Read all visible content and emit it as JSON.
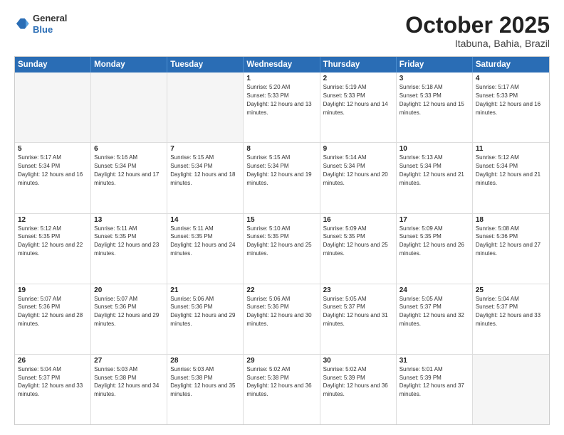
{
  "header": {
    "logo": {
      "general": "General",
      "blue": "Blue"
    },
    "title": "October 2025",
    "location": "Itabuna, Bahia, Brazil"
  },
  "calendar": {
    "days": [
      "Sunday",
      "Monday",
      "Tuesday",
      "Wednesday",
      "Thursday",
      "Friday",
      "Saturday"
    ],
    "rows": [
      [
        {
          "day": "",
          "empty": true
        },
        {
          "day": "",
          "empty": true
        },
        {
          "day": "",
          "empty": true
        },
        {
          "day": "1",
          "sunrise": "5:20 AM",
          "sunset": "5:33 PM",
          "daylight": "12 hours and 13 minutes."
        },
        {
          "day": "2",
          "sunrise": "5:19 AM",
          "sunset": "5:33 PM",
          "daylight": "12 hours and 14 minutes."
        },
        {
          "day": "3",
          "sunrise": "5:18 AM",
          "sunset": "5:33 PM",
          "daylight": "12 hours and 15 minutes."
        },
        {
          "day": "4",
          "sunrise": "5:17 AM",
          "sunset": "5:33 PM",
          "daylight": "12 hours and 16 minutes."
        }
      ],
      [
        {
          "day": "5",
          "sunrise": "5:17 AM",
          "sunset": "5:34 PM",
          "daylight": "12 hours and 16 minutes."
        },
        {
          "day": "6",
          "sunrise": "5:16 AM",
          "sunset": "5:34 PM",
          "daylight": "12 hours and 17 minutes."
        },
        {
          "day": "7",
          "sunrise": "5:15 AM",
          "sunset": "5:34 PM",
          "daylight": "12 hours and 18 minutes."
        },
        {
          "day": "8",
          "sunrise": "5:15 AM",
          "sunset": "5:34 PM",
          "daylight": "12 hours and 19 minutes."
        },
        {
          "day": "9",
          "sunrise": "5:14 AM",
          "sunset": "5:34 PM",
          "daylight": "12 hours and 20 minutes."
        },
        {
          "day": "10",
          "sunrise": "5:13 AM",
          "sunset": "5:34 PM",
          "daylight": "12 hours and 21 minutes."
        },
        {
          "day": "11",
          "sunrise": "5:12 AM",
          "sunset": "5:34 PM",
          "daylight": "12 hours and 21 minutes."
        }
      ],
      [
        {
          "day": "12",
          "sunrise": "5:12 AM",
          "sunset": "5:35 PM",
          "daylight": "12 hours and 22 minutes."
        },
        {
          "day": "13",
          "sunrise": "5:11 AM",
          "sunset": "5:35 PM",
          "daylight": "12 hours and 23 minutes."
        },
        {
          "day": "14",
          "sunrise": "5:11 AM",
          "sunset": "5:35 PM",
          "daylight": "12 hours and 24 minutes."
        },
        {
          "day": "15",
          "sunrise": "5:10 AM",
          "sunset": "5:35 PM",
          "daylight": "12 hours and 25 minutes."
        },
        {
          "day": "16",
          "sunrise": "5:09 AM",
          "sunset": "5:35 PM",
          "daylight": "12 hours and 25 minutes."
        },
        {
          "day": "17",
          "sunrise": "5:09 AM",
          "sunset": "5:35 PM",
          "daylight": "12 hours and 26 minutes."
        },
        {
          "day": "18",
          "sunrise": "5:08 AM",
          "sunset": "5:36 PM",
          "daylight": "12 hours and 27 minutes."
        }
      ],
      [
        {
          "day": "19",
          "sunrise": "5:07 AM",
          "sunset": "5:36 PM",
          "daylight": "12 hours and 28 minutes."
        },
        {
          "day": "20",
          "sunrise": "5:07 AM",
          "sunset": "5:36 PM",
          "daylight": "12 hours and 29 minutes."
        },
        {
          "day": "21",
          "sunrise": "5:06 AM",
          "sunset": "5:36 PM",
          "daylight": "12 hours and 29 minutes."
        },
        {
          "day": "22",
          "sunrise": "5:06 AM",
          "sunset": "5:36 PM",
          "daylight": "12 hours and 30 minutes."
        },
        {
          "day": "23",
          "sunrise": "5:05 AM",
          "sunset": "5:37 PM",
          "daylight": "12 hours and 31 minutes."
        },
        {
          "day": "24",
          "sunrise": "5:05 AM",
          "sunset": "5:37 PM",
          "daylight": "12 hours and 32 minutes."
        },
        {
          "day": "25",
          "sunrise": "5:04 AM",
          "sunset": "5:37 PM",
          "daylight": "12 hours and 33 minutes."
        }
      ],
      [
        {
          "day": "26",
          "sunrise": "5:04 AM",
          "sunset": "5:37 PM",
          "daylight": "12 hours and 33 minutes."
        },
        {
          "day": "27",
          "sunrise": "5:03 AM",
          "sunset": "5:38 PM",
          "daylight": "12 hours and 34 minutes."
        },
        {
          "day": "28",
          "sunrise": "5:03 AM",
          "sunset": "5:38 PM",
          "daylight": "12 hours and 35 minutes."
        },
        {
          "day": "29",
          "sunrise": "5:02 AM",
          "sunset": "5:38 PM",
          "daylight": "12 hours and 36 minutes."
        },
        {
          "day": "30",
          "sunrise": "5:02 AM",
          "sunset": "5:39 PM",
          "daylight": "12 hours and 36 minutes."
        },
        {
          "day": "31",
          "sunrise": "5:01 AM",
          "sunset": "5:39 PM",
          "daylight": "12 hours and 37 minutes."
        },
        {
          "day": "",
          "empty": true
        }
      ]
    ]
  }
}
